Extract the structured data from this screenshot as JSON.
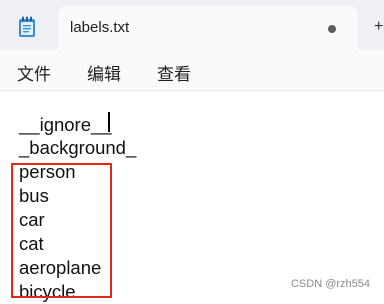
{
  "window": {
    "tab_title": "labels.txt",
    "new_tab_glyph": "+",
    "app_icon": "notepad-icon",
    "unsaved_indicator": "dot-icon"
  },
  "menu": {
    "items": [
      "文件",
      "编辑",
      "查看"
    ]
  },
  "editor": {
    "lines": [
      "__ignore__",
      "_background_",
      "person",
      "bus",
      "car",
      "cat",
      "aeroplane",
      "bicycle"
    ],
    "highlight_color": "#e4261c"
  },
  "watermark": "CSDN @rzh554"
}
